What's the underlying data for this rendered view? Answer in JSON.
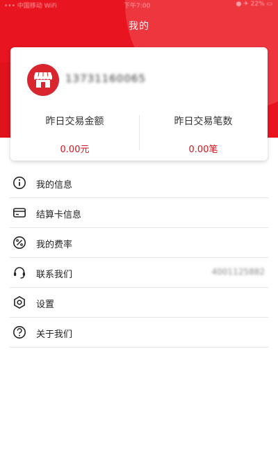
{
  "status_bar": {
    "left": "••• 中国移动 WiFi",
    "time": "下午7:00",
    "right": "● ✈ 22% ▭"
  },
  "header": {
    "title": "我的"
  },
  "profile": {
    "phone": "13731160065"
  },
  "stats": {
    "amount_label": "昨日交易金额",
    "amount_value": "0.00元",
    "count_label": "昨日交易笔数",
    "count_value": "0.00笔"
  },
  "menu": {
    "items": [
      {
        "label": "我的信息",
        "icon": "info-icon"
      },
      {
        "label": "结算卡信息",
        "icon": "card-icon"
      },
      {
        "label": "我的费率",
        "icon": "percent-icon"
      },
      {
        "label": "联系我们",
        "icon": "headset-icon",
        "extra": "4001125882"
      },
      {
        "label": "设置",
        "icon": "settings-icon"
      },
      {
        "label": "关于我们",
        "icon": "help-icon"
      }
    ]
  },
  "colors": {
    "brand_red": "#e8141f",
    "value_red": "#d4141e"
  }
}
